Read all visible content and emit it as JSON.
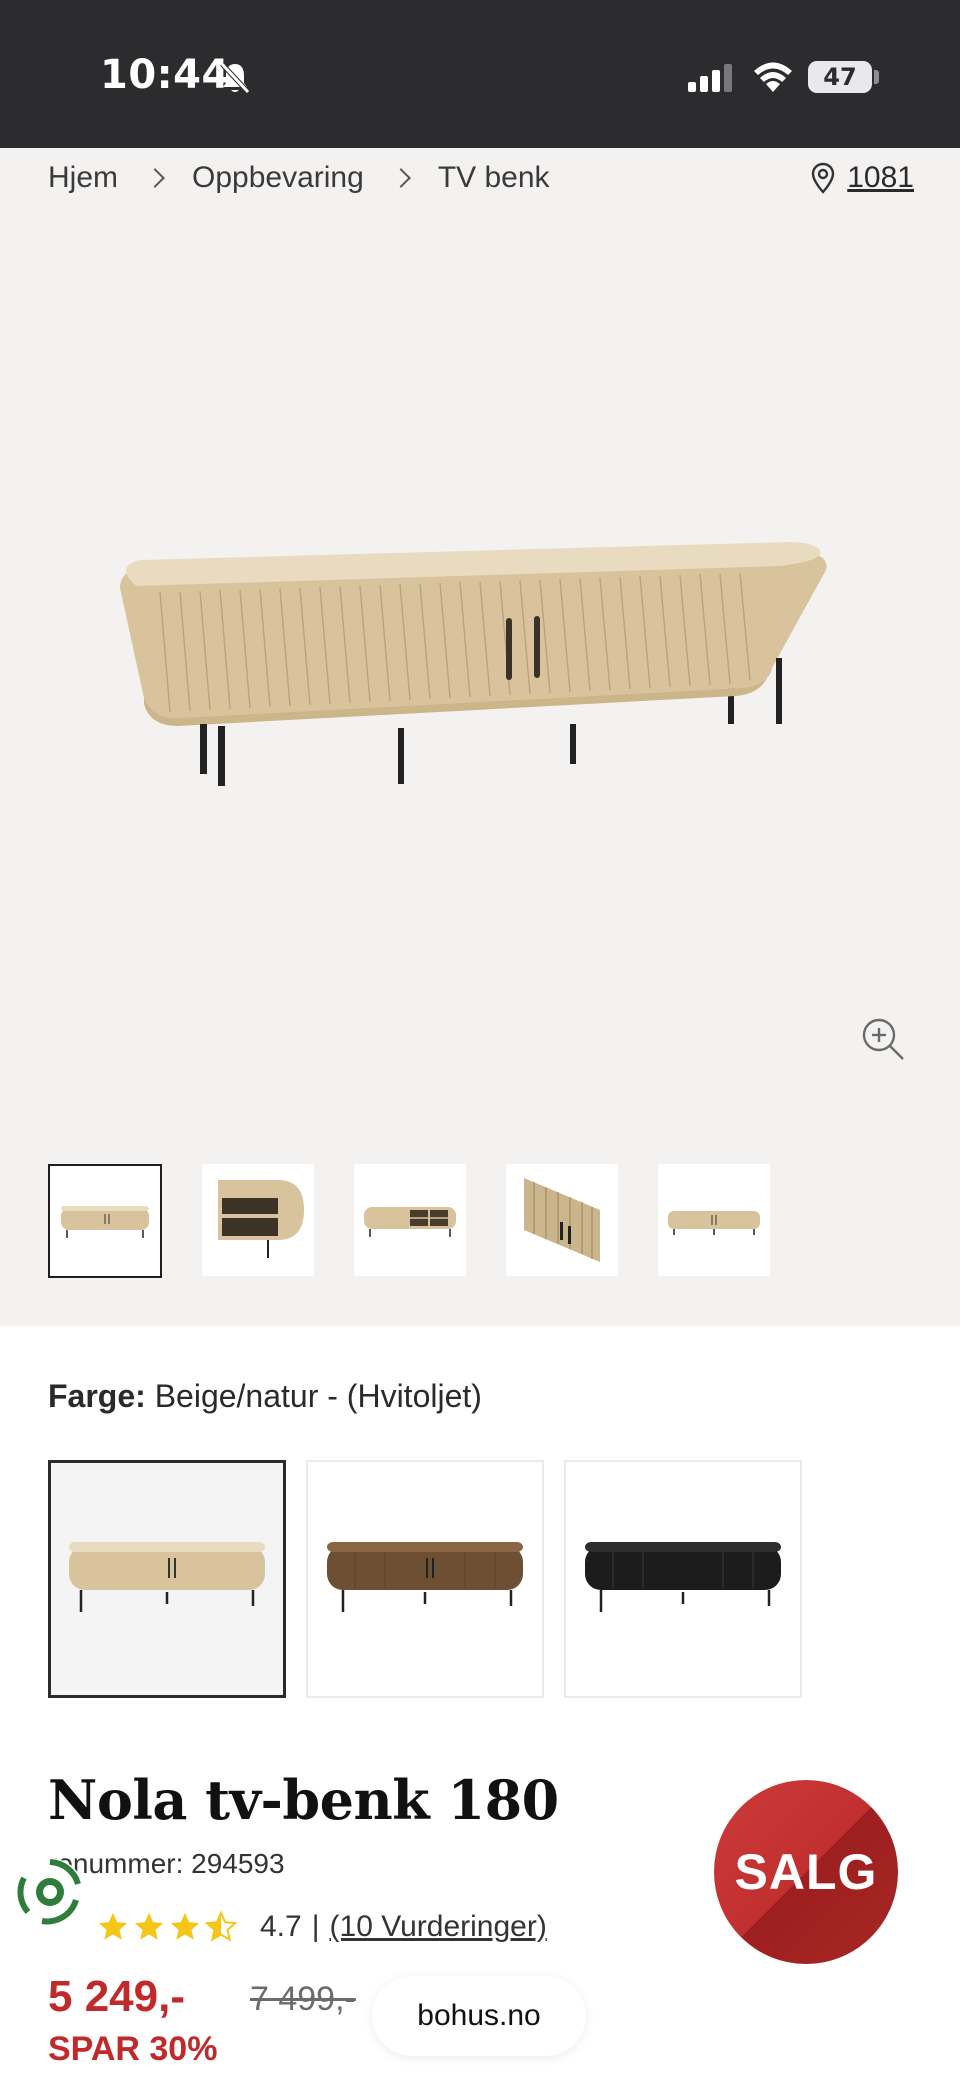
{
  "status_bar": {
    "time": "10:44",
    "battery": "47"
  },
  "breadcrumb": {
    "items": [
      "Hjem",
      "Oppbevaring",
      "TV benk"
    ],
    "store_number": "1081"
  },
  "gallery": {
    "thumbnails": [
      "thumb-front",
      "thumb-open-side",
      "thumb-open-front",
      "thumb-detail",
      "thumb-flat"
    ]
  },
  "color": {
    "label": "Farge:",
    "value": "Beige/natur - (Hvitoljet)",
    "swatches": [
      "beige",
      "brown",
      "black"
    ]
  },
  "product": {
    "title": "Nola tv-benk 180",
    "sku_label": "renummer: 294593",
    "rating_value": "4.7",
    "rating_sep": "|",
    "rating_count": "(10 Vurderinger)",
    "rating_stars": 4.5,
    "price": "5 249,-",
    "old_price": "7 499,-",
    "savings": "SPAR 30%"
  },
  "badge": {
    "sale": "SALG"
  },
  "browser": {
    "url": "bohus.no"
  },
  "colors": {
    "sale_red": "#c02a2a",
    "star_yellow": "#f5c518",
    "status_bar": "#2c2c2e"
  }
}
